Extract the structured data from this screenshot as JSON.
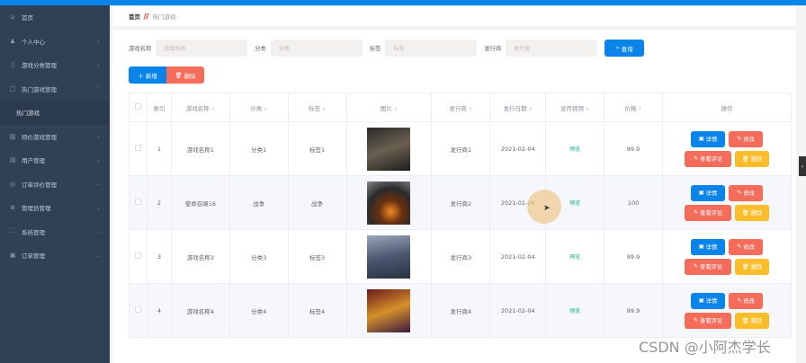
{
  "sidebar": {
    "items": [
      {
        "label": "首页",
        "icon": "home-icon",
        "chev": ""
      },
      {
        "label": "个人中心",
        "icon": "user-icon",
        "chev": "⌄"
      },
      {
        "label": "游戏分类管理",
        "icon": "phone-icon",
        "chev": "⌄"
      },
      {
        "label": "热门游戏管理",
        "icon": "square-icon",
        "chev": "⌃"
      },
      {
        "label": "热门游戏",
        "icon": "",
        "chev": "",
        "sub": true
      },
      {
        "label": "特价游戏管理",
        "icon": "chart-icon",
        "chev": "⌄"
      },
      {
        "label": "用户管理",
        "icon": "card-icon",
        "chev": "⌄"
      },
      {
        "label": "订单评价管理",
        "icon": "circle-icon",
        "chev": "⌄"
      },
      {
        "label": "管理员管理",
        "icon": "close-circle-icon",
        "chev": "⌄"
      },
      {
        "label": "系统管理",
        "icon": "frame-icon",
        "chev": "⌄"
      },
      {
        "label": "订单管理",
        "icon": "clipboard-icon",
        "chev": "⌄"
      }
    ]
  },
  "breadcrumb": {
    "home": "首页",
    "current": "热门游戏"
  },
  "search": {
    "fields": [
      {
        "label": "游戏名称",
        "placeholder": "游戏名称"
      },
      {
        "label": "分类",
        "placeholder": "分类"
      },
      {
        "label": "标签",
        "placeholder": "标签"
      },
      {
        "label": "发行商",
        "placeholder": "发行商"
      }
    ],
    "query": "查询"
  },
  "toolbar": {
    "add": "新增",
    "delete": "删除"
  },
  "table": {
    "headers": [
      "索引",
      "游戏名称",
      "分类",
      "标签",
      "图片",
      "发行商",
      "发行日期",
      "宣传视频",
      "价格",
      "操作"
    ],
    "rows": [
      {
        "index": "1",
        "name": "游戏名称1",
        "category": "分类1",
        "tag": "标签1",
        "publisher": "发行商1",
        "date": "2021-02-04",
        "video": "预览",
        "price": "99.9"
      },
      {
        "index": "2",
        "name": "使命召唤16",
        "category": "战争",
        "tag": "战争",
        "publisher": "发行商2",
        "date": "2021-01-28",
        "video": "预览",
        "price": "100"
      },
      {
        "index": "3",
        "name": "游戏名称3",
        "category": "分类3",
        "tag": "标签3",
        "publisher": "发行商3",
        "date": "2021-02-04",
        "video": "预览",
        "price": "99.9"
      },
      {
        "index": "4",
        "name": "游戏名称4",
        "category": "分类4",
        "tag": "标签4",
        "publisher": "发行商4",
        "date": "2021-02-04",
        "video": "预览",
        "price": "99.9"
      }
    ],
    "ops": {
      "detail": "详情",
      "edit": "修改",
      "review": "查看评论",
      "delete": "删除"
    }
  },
  "watermark": "CSDN @小阿杰学长",
  "colors": {
    "primary": "#0a84e8",
    "danger": "#f56c5b",
    "warning": "#fbbd2a",
    "sidebar": "#304156"
  }
}
